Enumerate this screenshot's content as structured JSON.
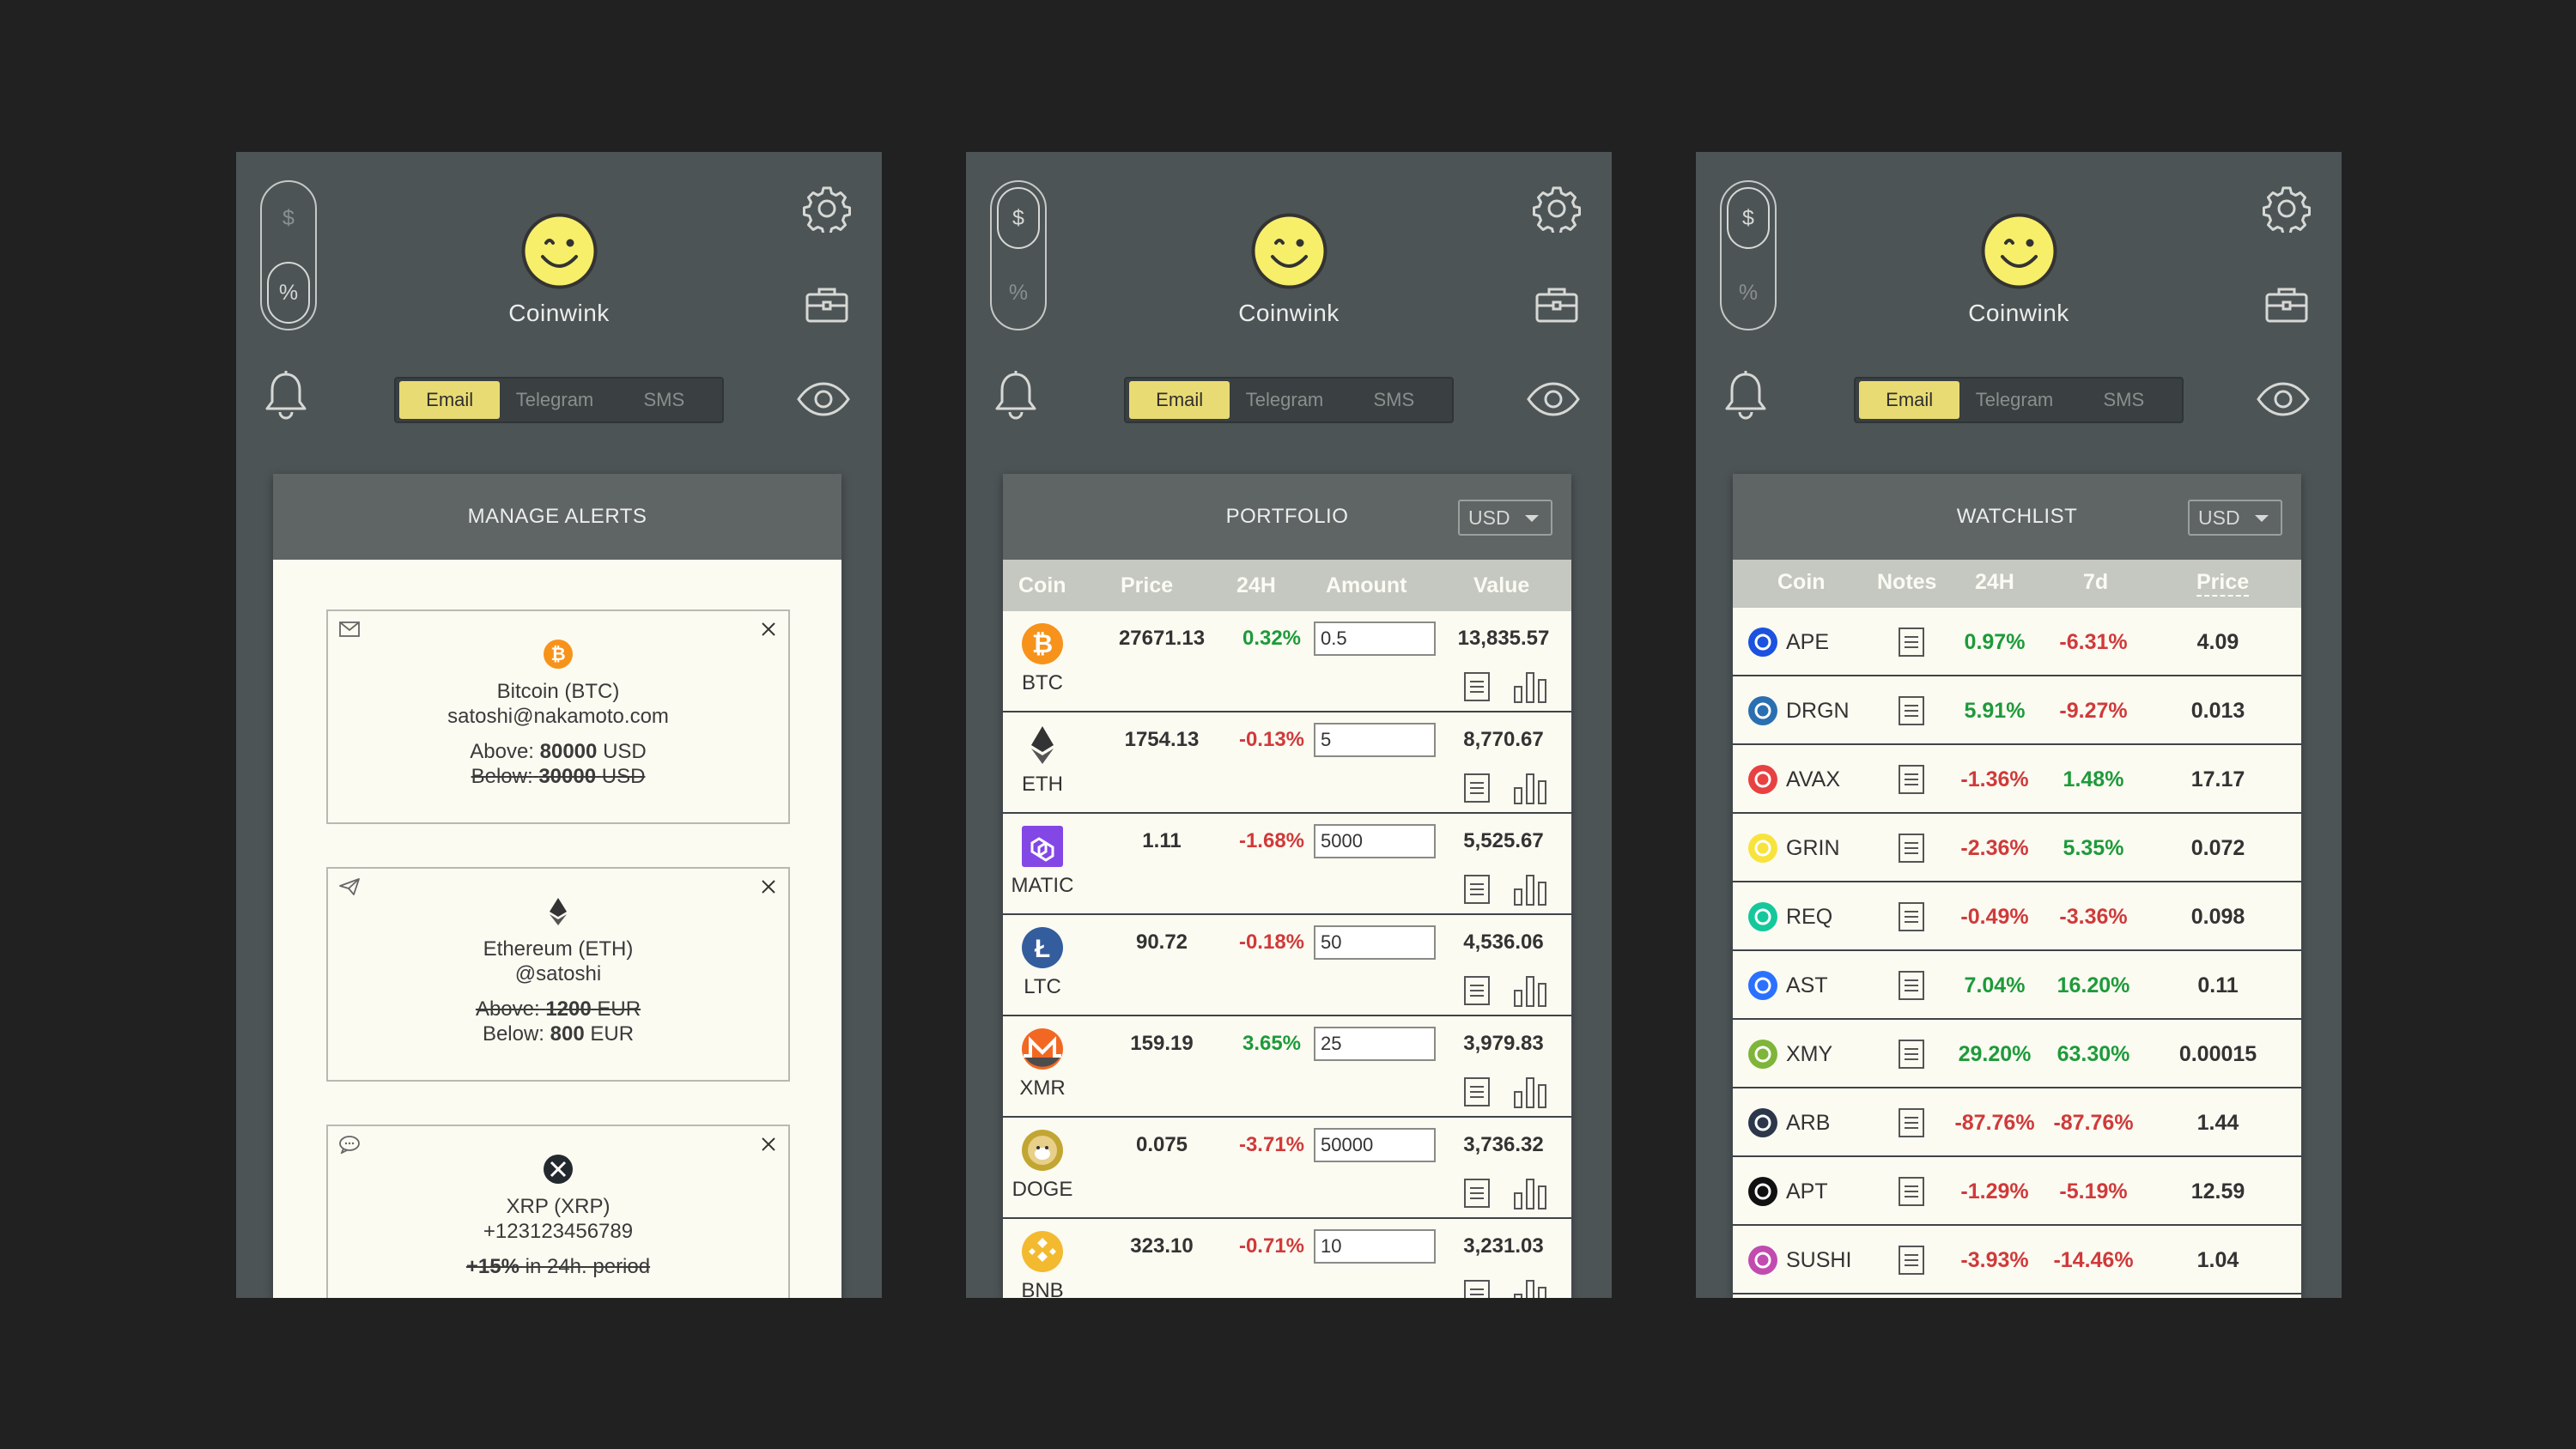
{
  "app": {
    "name": "Coinwink"
  },
  "toggle": {
    "dollar": "$",
    "percent": "%"
  },
  "channels": {
    "email": "Email",
    "telegram": "Telegram",
    "sms": "SMS"
  },
  "colors": {
    "background": "#212121",
    "panel": "#4d5456",
    "card": "#fbfbf2",
    "accent": "#e9db73",
    "positive": "#1e9a3a",
    "negative": "#d03a3a"
  },
  "alerts": {
    "title": "MANAGE ALERTS",
    "items": [
      {
        "channel_icon": "envelope-icon",
        "coin_icon": "bitcoin-icon",
        "coin": "Bitcoin (BTC)",
        "contact": "satoshi@nakamoto.com",
        "above_label": "Above:",
        "above_value": "80000",
        "above_unit": "USD",
        "below_label": "Below:",
        "below_value": "30000",
        "below_unit": "USD"
      },
      {
        "channel_icon": "paper-plane-icon",
        "coin_icon": "ethereum-icon",
        "coin": "Ethereum (ETH)",
        "contact": "@satoshi",
        "above_label": "Above:",
        "above_value": "1200",
        "above_unit": "EUR",
        "below_label": "Below:",
        "below_value": "800",
        "below_unit": "EUR"
      },
      {
        "channel_icon": "speech-bubble-icon",
        "coin_icon": "xrp-icon",
        "coin": "XRP (XRP)",
        "contact": "+123123456789",
        "percent_value": "+15%",
        "percent_text": "in 24h. period"
      }
    ]
  },
  "portfolio": {
    "title": "PORTFOLIO",
    "currency": "USD",
    "columns": {
      "coin": "Coin",
      "price": "Price",
      "change": "24H",
      "amount": "Amount",
      "value": "Value"
    },
    "rows": [
      {
        "symbol": "BTC",
        "icon": "bitcoin-icon",
        "price": "27671.13",
        "change": "0.32%",
        "trend": "up",
        "amount": "0.5",
        "value": "13,835.57"
      },
      {
        "symbol": "ETH",
        "icon": "ethereum-icon",
        "price": "1754.13",
        "change": "-0.13%",
        "trend": "down",
        "amount": "5",
        "value": "8,770.67"
      },
      {
        "symbol": "MATIC",
        "icon": "polygon-icon",
        "price": "1.11",
        "change": "-1.68%",
        "trend": "down",
        "amount": "5000",
        "value": "5,525.67"
      },
      {
        "symbol": "LTC",
        "icon": "litecoin-icon",
        "price": "90.72",
        "change": "-0.18%",
        "trend": "down",
        "amount": "50",
        "value": "4,536.06"
      },
      {
        "symbol": "XMR",
        "icon": "monero-icon",
        "price": "159.19",
        "change": "3.65%",
        "trend": "up",
        "amount": "25",
        "value": "3,979.83"
      },
      {
        "symbol": "DOGE",
        "icon": "dogecoin-icon",
        "price": "0.075",
        "change": "-3.71%",
        "trend": "down",
        "amount": "50000",
        "value": "3,736.32"
      },
      {
        "symbol": "BNB",
        "icon": "binance-icon",
        "price": "323.10",
        "change": "-0.71%",
        "trend": "down",
        "amount": "10",
        "value": "3,231.03"
      }
    ]
  },
  "watchlist": {
    "title": "WATCHLIST",
    "currency": "USD",
    "columns": {
      "coin": "Coin",
      "notes": "Notes",
      "change24": "24H",
      "change7": "7d",
      "price": "Price"
    },
    "rows": [
      {
        "symbol": "APE",
        "icon": "apecoin-icon",
        "c24": "0.97%",
        "t24": "up",
        "c7": "-6.31%",
        "t7": "down",
        "price": "4.09",
        "color": "#1b52e0"
      },
      {
        "symbol": "DRGN",
        "icon": "dragonchain-icon",
        "c24": "5.91%",
        "t24": "up",
        "c7": "-9.27%",
        "t7": "down",
        "price": "0.013",
        "color": "#2a6fb0"
      },
      {
        "symbol": "AVAX",
        "icon": "avalanche-icon",
        "c24": "-1.36%",
        "t24": "down",
        "c7": "1.48%",
        "t7": "up",
        "price": "17.17",
        "color": "#e84142"
      },
      {
        "symbol": "GRIN",
        "icon": "grin-icon",
        "c24": "-2.36%",
        "t24": "down",
        "c7": "5.35%",
        "t7": "up",
        "price": "0.072",
        "color": "#f7e33c"
      },
      {
        "symbol": "REQ",
        "icon": "request-icon",
        "c24": "-0.49%",
        "t24": "down",
        "c7": "-3.36%",
        "t7": "down",
        "price": "0.098",
        "color": "#15c89c"
      },
      {
        "symbol": "AST",
        "icon": "airswap-icon",
        "c24": "7.04%",
        "t24": "up",
        "c7": "16.20%",
        "t7": "up",
        "price": "0.11",
        "color": "#2b71ff"
      },
      {
        "symbol": "XMY",
        "icon": "myriad-icon",
        "c24": "29.20%",
        "t24": "up",
        "c7": "63.30%",
        "t7": "up",
        "price": "0.00015",
        "color": "#7fb53a"
      },
      {
        "symbol": "ARB",
        "icon": "arbitrum-icon",
        "c24": "-87.76%",
        "t24": "down",
        "c7": "-87.76%",
        "t7": "down",
        "price": "1.44",
        "color": "#2d374b"
      },
      {
        "symbol": "APT",
        "icon": "aptos-icon",
        "c24": "-1.29%",
        "t24": "down",
        "c7": "-5.19%",
        "t7": "down",
        "price": "12.59",
        "color": "#111111"
      },
      {
        "symbol": "SUSHI",
        "icon": "sushi-icon",
        "c24": "-3.93%",
        "t24": "down",
        "c7": "-14.46%",
        "t7": "down",
        "price": "1.04",
        "color": "#c24bb0"
      }
    ]
  }
}
